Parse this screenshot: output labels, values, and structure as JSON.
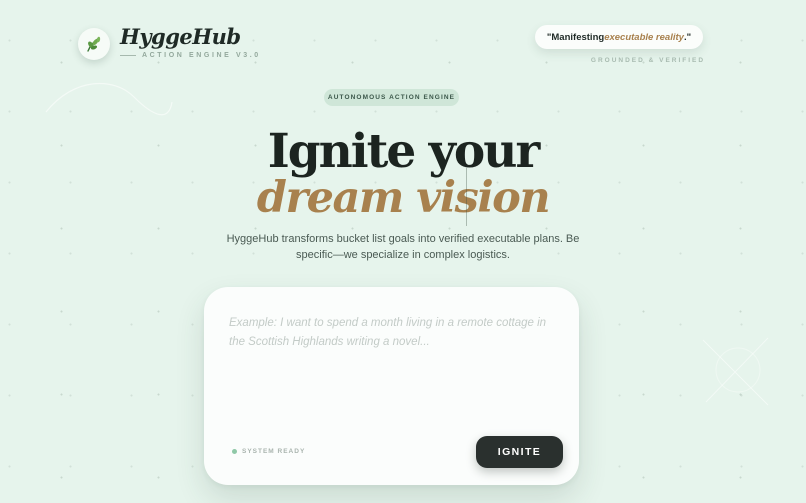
{
  "brand": {
    "name": "HyggeHub",
    "subtitle": "ACTION ENGINE V3.0",
    "logo_icon": "leaf-icon"
  },
  "quote": {
    "prefix": "\"Manifesting ",
    "accent": "executable reality",
    "suffix": ".\"",
    "caption": "GROUNDED & VERIFIED"
  },
  "hero": {
    "badge": "AUTONOMOUS ACTION ENGINE",
    "headline_line1": "Ignite your",
    "headline_line2": "dream vision",
    "description": "HyggeHub transforms bucket list goals into verified executable plans. Be specific—we specialize in complex logistics."
  },
  "composer": {
    "value": "",
    "placeholder": "Example: I want to spend a month living in a remote cottage in the Scottish Highlands writing a novel...",
    "status": "SYSTEM READY",
    "submit_label": "IGNITE"
  },
  "colors": {
    "background": "#e6f4ec",
    "accent_gold": "#a8814e",
    "dark": "#2a302e",
    "status_green": "#8fc8a7"
  }
}
